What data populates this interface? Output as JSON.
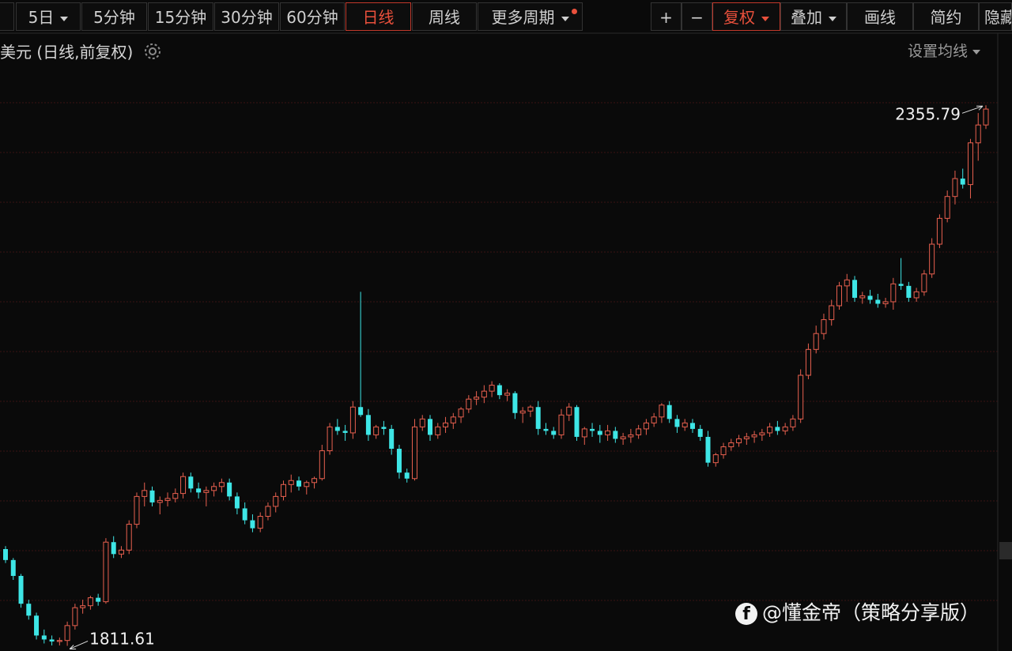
{
  "toolbar": {
    "period_5d": "5日",
    "m5": "5分钟",
    "m15": "15分钟",
    "m30": "30分钟",
    "m60": "60分钟",
    "daily": "日线",
    "weekly": "周线",
    "more": "更多周期",
    "zoom_in": "+",
    "zoom_out": "−",
    "adjust": "复权",
    "overlay": "叠加",
    "draw": "画线",
    "simple": "简约",
    "hide": "隐藏"
  },
  "header": {
    "instrument": "美元",
    "mode": "(日线,前复权)",
    "set_ma": "设置均线"
  },
  "watermark": {
    "text": "@懂金帝（策略分享版）"
  },
  "colors": {
    "up": "#e8604f",
    "down": "#3ee6e6",
    "grid": "#3a1414",
    "active": "#e9503c"
  },
  "chart_data": {
    "type": "candlestick",
    "ylim": [
      1780,
      2380
    ],
    "grid": "horizontal",
    "annotations": {
      "high": "2355.79",
      "low": "1811.61"
    },
    "high_value": 2355.79,
    "low_value": 1811.61,
    "candles": [
      [
        1909,
        1912,
        1895,
        1898
      ],
      [
        1898,
        1900,
        1878,
        1882
      ],
      [
        1882,
        1884,
        1850,
        1854
      ],
      [
        1854,
        1858,
        1838,
        1842
      ],
      [
        1842,
        1845,
        1818,
        1822
      ],
      [
        1822,
        1828,
        1814,
        1818
      ],
      [
        1818,
        1822,
        1812,
        1816
      ],
      [
        1816,
        1820,
        1812,
        1817
      ],
      [
        1817,
        1836,
        1811.61,
        1832
      ],
      [
        1832,
        1854,
        1828,
        1850
      ],
      [
        1850,
        1858,
        1844,
        1852
      ],
      [
        1852,
        1862,
        1848,
        1860
      ],
      [
        1860,
        1864,
        1852,
        1856
      ],
      [
        1856,
        1920,
        1854,
        1916
      ],
      [
        1916,
        1922,
        1900,
        1904
      ],
      [
        1904,
        1912,
        1900,
        1908
      ],
      [
        1908,
        1938,
        1904,
        1934
      ],
      [
        1934,
        1966,
        1930,
        1962
      ],
      [
        1962,
        1976,
        1952,
        1968
      ],
      [
        1968,
        1972,
        1952,
        1956
      ],
      [
        1956,
        1962,
        1944,
        1958
      ],
      [
        1958,
        1966,
        1952,
        1960
      ],
      [
        1960,
        1970,
        1956,
        1965
      ],
      [
        1965,
        1986,
        1960,
        1982
      ],
      [
        1982,
        1986,
        1966,
        1970
      ],
      [
        1970,
        1976,
        1960,
        1966
      ],
      [
        1966,
        1972,
        1952,
        1968
      ],
      [
        1968,
        1976,
        1962,
        1972
      ],
      [
        1972,
        1980,
        1966,
        1976
      ],
      [
        1976,
        1980,
        1958,
        1962
      ],
      [
        1962,
        1966,
        1944,
        1950
      ],
      [
        1950,
        1956,
        1934,
        1938
      ],
      [
        1938,
        1944,
        1926,
        1930
      ],
      [
        1930,
        1946,
        1926,
        1942
      ],
      [
        1942,
        1956,
        1938,
        1952
      ],
      [
        1952,
        1966,
        1946,
        1962
      ],
      [
        1962,
        1978,
        1958,
        1974
      ],
      [
        1974,
        1984,
        1966,
        1978
      ],
      [
        1978,
        1982,
        1968,
        1972
      ],
      [
        1972,
        1978,
        1964,
        1976
      ],
      [
        1976,
        1982,
        1970,
        1980
      ],
      [
        1980,
        2014,
        1978,
        2008
      ],
      [
        2008,
        2036,
        2004,
        2032
      ],
      [
        2032,
        2040,
        2024,
        2028
      ],
      [
        2028,
        2034,
        2018,
        2026
      ],
      [
        2026,
        2058,
        2020,
        2052
      ],
      [
        2052,
        2168,
        2042,
        2044
      ],
      [
        2044,
        2050,
        2018,
        2024
      ],
      [
        2024,
        2034,
        2020,
        2032
      ],
      [
        2032,
        2038,
        2024,
        2030
      ],
      [
        2030,
        2034,
        2004,
        2010
      ],
      [
        2010,
        2014,
        1980,
        1986
      ],
      [
        1986,
        1990,
        1976,
        1980
      ],
      [
        1980,
        2040,
        1978,
        2032
      ],
      [
        2032,
        2044,
        2028,
        2040
      ],
      [
        2040,
        2044,
        2018,
        2024
      ],
      [
        2024,
        2036,
        2020,
        2032
      ],
      [
        2032,
        2042,
        2026,
        2036
      ],
      [
        2036,
        2046,
        2030,
        2042
      ],
      [
        2042,
        2052,
        2036,
        2050
      ],
      [
        2050,
        2064,
        2046,
        2060
      ],
      [
        2060,
        2068,
        2054,
        2062
      ],
      [
        2062,
        2074,
        2056,
        2068
      ],
      [
        2068,
        2078,
        2062,
        2074
      ],
      [
        2074,
        2076,
        2060,
        2064
      ],
      [
        2064,
        2070,
        2058,
        2066
      ],
      [
        2066,
        2068,
        2040,
        2046
      ],
      [
        2046,
        2052,
        2036,
        2048
      ],
      [
        2048,
        2054,
        2042,
        2052
      ],
      [
        2052,
        2058,
        2024,
        2030
      ],
      [
        2030,
        2036,
        2024,
        2028
      ],
      [
        2028,
        2032,
        2020,
        2024
      ],
      [
        2024,
        2050,
        2020,
        2044
      ],
      [
        2044,
        2056,
        2038,
        2052
      ],
      [
        2052,
        2054,
        2018,
        2022
      ],
      [
        2022,
        2032,
        2014,
        2030
      ],
      [
        2030,
        2036,
        2022,
        2028
      ],
      [
        2028,
        2034,
        2016,
        2024
      ],
      [
        2024,
        2034,
        2018,
        2028
      ],
      [
        2028,
        2032,
        2016,
        2020
      ],
      [
        2020,
        2026,
        2014,
        2022
      ],
      [
        2022,
        2030,
        2016,
        2024
      ],
      [
        2024,
        2034,
        2020,
        2030
      ],
      [
        2030,
        2040,
        2024,
        2036
      ],
      [
        2036,
        2046,
        2032,
        2042
      ],
      [
        2042,
        2056,
        2036,
        2054
      ],
      [
        2054,
        2058,
        2036,
        2040
      ],
      [
        2040,
        2044,
        2026,
        2032
      ],
      [
        2032,
        2040,
        2028,
        2036
      ],
      [
        2036,
        2040,
        2026,
        2030
      ],
      [
        2030,
        2034,
        2018,
        2022
      ],
      [
        2022,
        2028,
        1992,
        1996
      ],
      [
        1996,
        2006,
        1992,
        2004
      ],
      [
        2004,
        2016,
        2000,
        2012
      ],
      [
        2012,
        2020,
        2008,
        2016
      ],
      [
        2016,
        2024,
        2012,
        2020
      ],
      [
        2020,
        2026,
        2014,
        2022
      ],
      [
        2022,
        2028,
        2016,
        2024
      ],
      [
        2024,
        2030,
        2018,
        2026
      ],
      [
        2026,
        2036,
        2022,
        2032
      ],
      [
        2032,
        2038,
        2024,
        2028
      ],
      [
        2028,
        2036,
        2024,
        2032
      ],
      [
        2032,
        2044,
        2028,
        2040
      ],
      [
        2040,
        2090,
        2036,
        2084
      ],
      [
        2084,
        2116,
        2080,
        2110
      ],
      [
        2110,
        2134,
        2106,
        2126
      ],
      [
        2126,
        2146,
        2120,
        2140
      ],
      [
        2140,
        2160,
        2134,
        2154
      ],
      [
        2154,
        2178,
        2150,
        2174
      ],
      [
        2174,
        2186,
        2158,
        2180
      ],
      [
        2180,
        2184,
        2158,
        2162
      ],
      [
        2162,
        2168,
        2156,
        2164
      ],
      [
        2164,
        2170,
        2156,
        2160
      ],
      [
        2160,
        2166,
        2152,
        2156
      ],
      [
        2156,
        2162,
        2152,
        2158
      ],
      [
        2158,
        2182,
        2150,
        2176
      ],
      [
        2176,
        2202,
        2170,
        2174
      ],
      [
        2174,
        2178,
        2158,
        2162
      ],
      [
        2162,
        2172,
        2158,
        2168
      ],
      [
        2168,
        2190,
        2164,
        2186
      ],
      [
        2186,
        2222,
        2182,
        2216
      ],
      [
        2216,
        2246,
        2212,
        2242
      ],
      [
        2242,
        2270,
        2238,
        2264
      ],
      [
        2264,
        2290,
        2256,
        2282
      ],
      [
        2282,
        2292,
        2272,
        2276
      ],
      [
        2276,
        2322,
        2262,
        2318
      ],
      [
        2318,
        2348,
        2300,
        2336
      ],
      [
        2336,
        2355.79,
        2332,
        2352
      ]
    ]
  }
}
